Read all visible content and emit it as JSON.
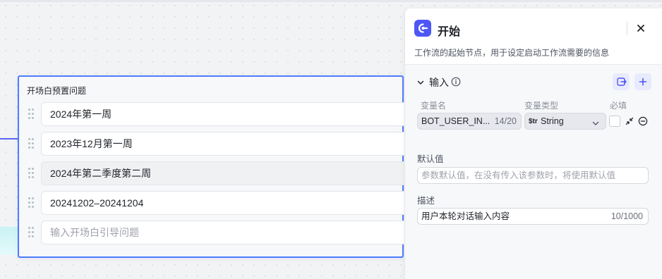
{
  "card": {
    "title": "开场白预置问题",
    "questions": [
      {
        "text": "2024年第一周"
      },
      {
        "text": "2023年12月第一周"
      },
      {
        "text": "2024年第二季度第二周"
      },
      {
        "text": "20241202–20241204"
      }
    ],
    "new_question_placeholder": "输入开场白引导问题"
  },
  "panel": {
    "title": "开始",
    "description": "工作流的起始节点，用于设定启动工作流需要的信息",
    "input_section": {
      "title": "输入",
      "columns": {
        "name": "变量名",
        "type": "变量类型",
        "required": "必填"
      },
      "variable": {
        "name": "BOT_USER_IN...",
        "name_count": "14/20",
        "type_icon": "$tr",
        "type": "String"
      },
      "default_label": "默认值",
      "default_placeholder": "参数默认值，在没有传入该参数时，将使用默认值",
      "desc_label": "描述",
      "desc_value": "用户本轮对话输入内容",
      "desc_count": "10/1000"
    }
  },
  "colors": {
    "accent": "#4e56f6",
    "card_border": "#4d7cff",
    "connector": "#5b63f5"
  },
  "icons": [
    "drag-handle-icon",
    "start-node-icon",
    "close-icon",
    "chevron-down-icon",
    "info-icon",
    "import-icon",
    "plus-icon",
    "expand-icon",
    "remove-icon"
  ]
}
